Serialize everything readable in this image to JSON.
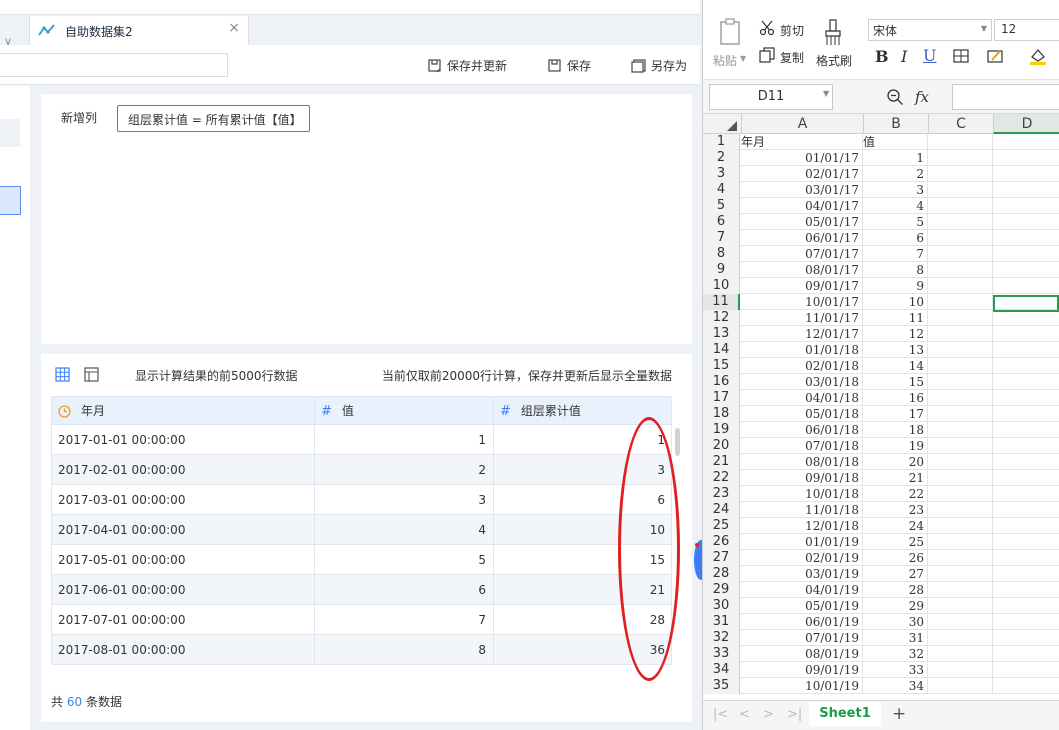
{
  "tab": {
    "title": "自助数据集2",
    "close": "×"
  },
  "toolbar": {
    "save_update": "保存并更新",
    "save": "保存",
    "save_as": "另存为"
  },
  "editor": {
    "label": "新增列",
    "formula": "组层累计值 = 所有累计值【值】"
  },
  "preview": {
    "info": "显示计算结果的前5000行数据",
    "note": "当前仅取前20000行计算，保存并更新后显示全量数据",
    "columns": [
      "年月",
      "值",
      "组层累计值"
    ],
    "rows": [
      [
        "2017-01-01 00:00:00",
        "1",
        "1"
      ],
      [
        "2017-02-01 00:00:00",
        "2",
        "3"
      ],
      [
        "2017-03-01 00:00:00",
        "3",
        "6"
      ],
      [
        "2017-04-01 00:00:00",
        "4",
        "10"
      ],
      [
        "2017-05-01 00:00:00",
        "5",
        "15"
      ],
      [
        "2017-06-01 00:00:00",
        "6",
        "21"
      ],
      [
        "2017-07-01 00:00:00",
        "7",
        "28"
      ],
      [
        "2017-08-01 00:00:00",
        "8",
        "36"
      ]
    ],
    "footer_prefix": "共",
    "footer_count": "60",
    "footer_suffix": "条数据"
  },
  "excel": {
    "ribbon": {
      "paste": "粘贴",
      "cut": "剪切",
      "copy": "复制",
      "format_painter": "格式刷",
      "font": "宋体",
      "size": "12"
    },
    "name_box": "D11",
    "fx": "fx",
    "columns": [
      "A",
      "B",
      "C",
      "D"
    ],
    "sheet": "Sheet1",
    "header_row": [
      "年月",
      "值"
    ],
    "rows": [
      [
        "01/01/17",
        "1"
      ],
      [
        "02/01/17",
        "2"
      ],
      [
        "03/01/17",
        "3"
      ],
      [
        "04/01/17",
        "4"
      ],
      [
        "05/01/17",
        "5"
      ],
      [
        "06/01/17",
        "6"
      ],
      [
        "07/01/17",
        "7"
      ],
      [
        "08/01/17",
        "8"
      ],
      [
        "09/01/17",
        "9"
      ],
      [
        "10/01/17",
        "10"
      ],
      [
        "11/01/17",
        "11"
      ],
      [
        "12/01/17",
        "12"
      ],
      [
        "01/01/18",
        "13"
      ],
      [
        "02/01/18",
        "14"
      ],
      [
        "03/01/18",
        "15"
      ],
      [
        "04/01/18",
        "16"
      ],
      [
        "05/01/18",
        "17"
      ],
      [
        "06/01/18",
        "18"
      ],
      [
        "07/01/18",
        "19"
      ],
      [
        "08/01/18",
        "20"
      ],
      [
        "09/01/18",
        "21"
      ],
      [
        "10/01/18",
        "22"
      ],
      [
        "11/01/18",
        "23"
      ],
      [
        "12/01/18",
        "24"
      ],
      [
        "01/01/19",
        "25"
      ],
      [
        "02/01/19",
        "26"
      ],
      [
        "03/01/19",
        "27"
      ],
      [
        "04/01/19",
        "28"
      ],
      [
        "05/01/19",
        "29"
      ],
      [
        "06/01/19",
        "30"
      ],
      [
        "07/01/19",
        "31"
      ],
      [
        "08/01/19",
        "32"
      ],
      [
        "09/01/19",
        "33"
      ],
      [
        "10/01/19",
        "34"
      ]
    ]
  }
}
